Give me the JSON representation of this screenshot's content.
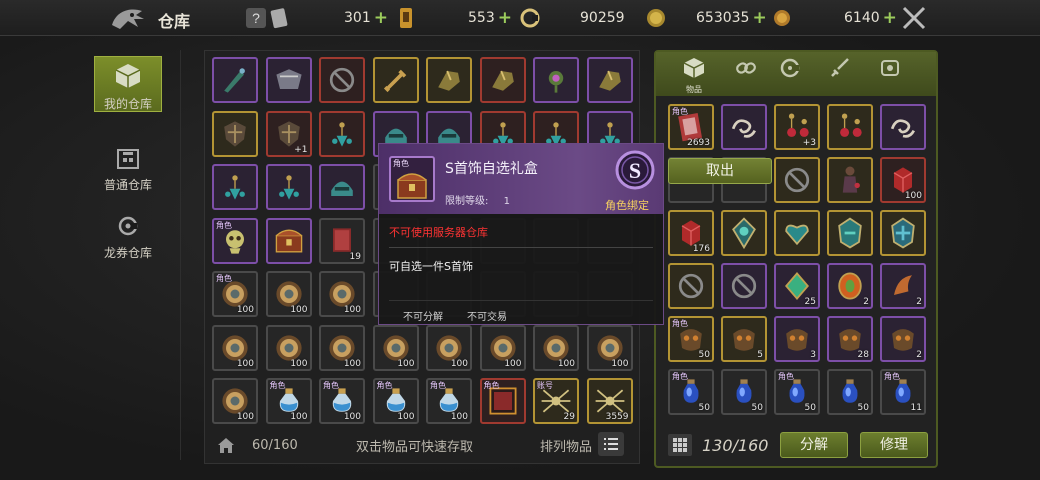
{
  "topbar": {
    "title": "仓库",
    "currencies": [
      {
        "name": "help-ticket",
        "value": "301"
      },
      {
        "name": "voucher",
        "value": "553"
      },
      {
        "name": "spiral-coin",
        "value": "90259"
      },
      {
        "name": "gold-coin",
        "value": "653035"
      },
      {
        "name": "bronze-coin",
        "value": "6140"
      }
    ]
  },
  "sidebar": {
    "tabs": [
      {
        "label": "我的仓库",
        "active": true
      },
      {
        "label": "普通仓库",
        "active": false
      },
      {
        "label": "龙券仓库",
        "active": false
      }
    ]
  },
  "main": {
    "capacity": "60/160",
    "hint": "双击物品可快速存取",
    "sort_label": "排列物品",
    "rows": [
      [
        {
          "r": "purple",
          "i": "dagger"
        },
        {
          "r": "purple",
          "i": "armor"
        },
        {
          "r": "red",
          "i": "lock"
        },
        {
          "r": "gold",
          "i": "sword"
        },
        {
          "r": "gold",
          "i": "gauntlet"
        },
        {
          "r": "red",
          "i": "gauntlet"
        },
        {
          "r": "purple",
          "i": "gem-flower"
        },
        {
          "r": "purple",
          "i": "gauntlet"
        }
      ],
      [
        {
          "r": "gold",
          "i": "shield"
        },
        {
          "r": "red",
          "i": "shield",
          "plus": "+1"
        },
        {
          "r": "red",
          "i": "earring"
        },
        {
          "r": "purple",
          "i": "helm"
        },
        {
          "r": "purple",
          "i": "helm"
        },
        {
          "r": "red",
          "i": "earring"
        },
        {
          "r": "red",
          "i": "earring"
        },
        {
          "r": "purple",
          "i": "earring"
        }
      ],
      [
        {
          "r": "purple",
          "i": "earring"
        },
        {
          "r": "purple",
          "i": "earring"
        },
        {
          "r": "purple",
          "i": "helm"
        },
        {
          "r": "grey",
          "i": "empty"
        },
        {
          "r": "grey",
          "i": "empty"
        },
        {
          "r": "grey",
          "i": "empty"
        },
        {
          "r": "grey",
          "i": "empty"
        },
        {
          "r": "grey",
          "i": "empty"
        }
      ],
      [
        {
          "r": "purple",
          "i": "skull",
          "tag": "角色"
        },
        {
          "r": "purple",
          "i": "chest"
        },
        {
          "r": "grey",
          "i": "book",
          "cnt": "19"
        },
        {
          "r": "grey",
          "i": "empty"
        },
        {
          "r": "grey",
          "i": "empty"
        },
        {
          "r": "grey",
          "i": "empty"
        },
        {
          "r": "grey",
          "i": "empty"
        },
        {
          "r": "grey",
          "i": "empty"
        }
      ],
      [
        {
          "r": "grey",
          "i": "coin",
          "tag": "角色",
          "cnt": "100"
        },
        {
          "r": "grey",
          "i": "coin",
          "cnt": "100"
        },
        {
          "r": "grey",
          "i": "coin",
          "cnt": "100"
        },
        {
          "r": "grey",
          "i": "empty"
        },
        {
          "r": "grey",
          "i": "empty"
        },
        {
          "r": "grey",
          "i": "empty"
        },
        {
          "r": "grey",
          "i": "empty"
        },
        {
          "r": "grey",
          "i": "empty"
        }
      ],
      [
        {
          "r": "grey",
          "i": "coin",
          "cnt": "100"
        },
        {
          "r": "grey",
          "i": "coin",
          "cnt": "100"
        },
        {
          "r": "grey",
          "i": "coin",
          "cnt": "100"
        },
        {
          "r": "grey",
          "i": "coin",
          "cnt": "100"
        },
        {
          "r": "grey",
          "i": "coin",
          "cnt": "100"
        },
        {
          "r": "grey",
          "i": "coin",
          "cnt": "100"
        },
        {
          "r": "grey",
          "i": "coin",
          "cnt": "100"
        },
        {
          "r": "grey",
          "i": "coin",
          "cnt": "100"
        }
      ],
      [
        {
          "r": "grey",
          "i": "coin",
          "cnt": "100"
        },
        {
          "r": "grey",
          "i": "potion",
          "tag": "角色",
          "cnt": "100"
        },
        {
          "r": "grey",
          "i": "potion",
          "tag": "角色",
          "cnt": "100"
        },
        {
          "r": "grey",
          "i": "potion",
          "tag": "角色",
          "cnt": "100"
        },
        {
          "r": "grey",
          "i": "potion",
          "tag": "角色",
          "cnt": "100"
        },
        {
          "r": "red",
          "i": "scroll",
          "tag": "角色"
        },
        {
          "r": "gold",
          "i": "spider",
          "tag": "账号",
          "cnt": "29"
        },
        {
          "r": "gold",
          "i": "spider",
          "cnt": "3559"
        }
      ]
    ]
  },
  "right": {
    "tabs": [
      {
        "label": "物品",
        "icon": "box-icon"
      },
      {
        "label": "",
        "icon": "chain-icon"
      },
      {
        "label": "",
        "icon": "orb-icon"
      },
      {
        "label": "",
        "icon": "sword-icon"
      },
      {
        "label": "",
        "icon": "scroll-icon"
      }
    ],
    "capacity": "130/160",
    "decompose_label": "分解",
    "repair_label": "修理",
    "take_out_label": "取出",
    "rows": [
      [
        {
          "r": "gold",
          "i": "card",
          "tag": "角色",
          "cnt": "2693"
        },
        {
          "r": "purple",
          "i": "swirl"
        },
        {
          "r": "gold",
          "i": "earring-r",
          "plus": "+3"
        },
        {
          "r": "gold",
          "i": "earring-r"
        },
        {
          "r": "purple",
          "i": "swirl"
        }
      ],
      [
        {
          "r": "grey",
          "i": "empty"
        },
        {
          "r": "grey",
          "i": "empty"
        },
        {
          "r": "gold",
          "i": "lock"
        },
        {
          "r": "gold",
          "i": "figure"
        },
        {
          "r": "red",
          "i": "redcube",
          "cnt": "100"
        }
      ],
      [
        {
          "r": "gold",
          "i": "redcube",
          "cnt": "176"
        },
        {
          "r": "gold",
          "i": "amulet"
        },
        {
          "r": "gold",
          "i": "heart"
        },
        {
          "r": "gold",
          "i": "amulet2"
        },
        {
          "r": "gold",
          "i": "amulet3"
        }
      ],
      [
        {
          "r": "gold",
          "i": "lock"
        },
        {
          "r": "purple",
          "i": "lock"
        },
        {
          "r": "purple",
          "i": "gem-green",
          "cnt": "25"
        },
        {
          "r": "purple",
          "i": "gem-orange",
          "cnt": "2"
        },
        {
          "r": "purple",
          "i": "claw",
          "cnt": "2"
        }
      ],
      [
        {
          "r": "gold",
          "i": "mask",
          "tag": "角色",
          "cnt": "50"
        },
        {
          "r": "gold",
          "i": "mask",
          "cnt": "5"
        },
        {
          "r": "purple",
          "i": "mask",
          "cnt": "3"
        },
        {
          "r": "purple",
          "i": "mask",
          "cnt": "28"
        },
        {
          "r": "purple",
          "i": "mask",
          "cnt": "2"
        }
      ],
      [
        {
          "r": "grey",
          "i": "bluepot",
          "tag": "角色",
          "cnt": "50"
        },
        {
          "r": "grey",
          "i": "bluepot",
          "cnt": "50"
        },
        {
          "r": "grey",
          "i": "bluepot",
          "tag": "角色",
          "cnt": "50"
        },
        {
          "r": "grey",
          "i": "bluepot",
          "cnt": "50"
        },
        {
          "r": "grey",
          "i": "bluepot",
          "tag": "角色",
          "cnt": "11"
        }
      ]
    ]
  },
  "tooltip": {
    "tag": "角色",
    "name": "S首饰自选礼盒",
    "level_label": "限制等级:",
    "level_value": "1",
    "bind": "角色绑定",
    "warning": "不可使用服务器仓库",
    "description": "可自选一件S首饰",
    "flags": [
      "不可分解",
      "不可交易"
    ],
    "grade_letter": "S"
  },
  "colors": {
    "accent": "#6c7e2e",
    "purple": "#7d4fa8",
    "gold": "#b39434",
    "warn": "#ff3333"
  }
}
